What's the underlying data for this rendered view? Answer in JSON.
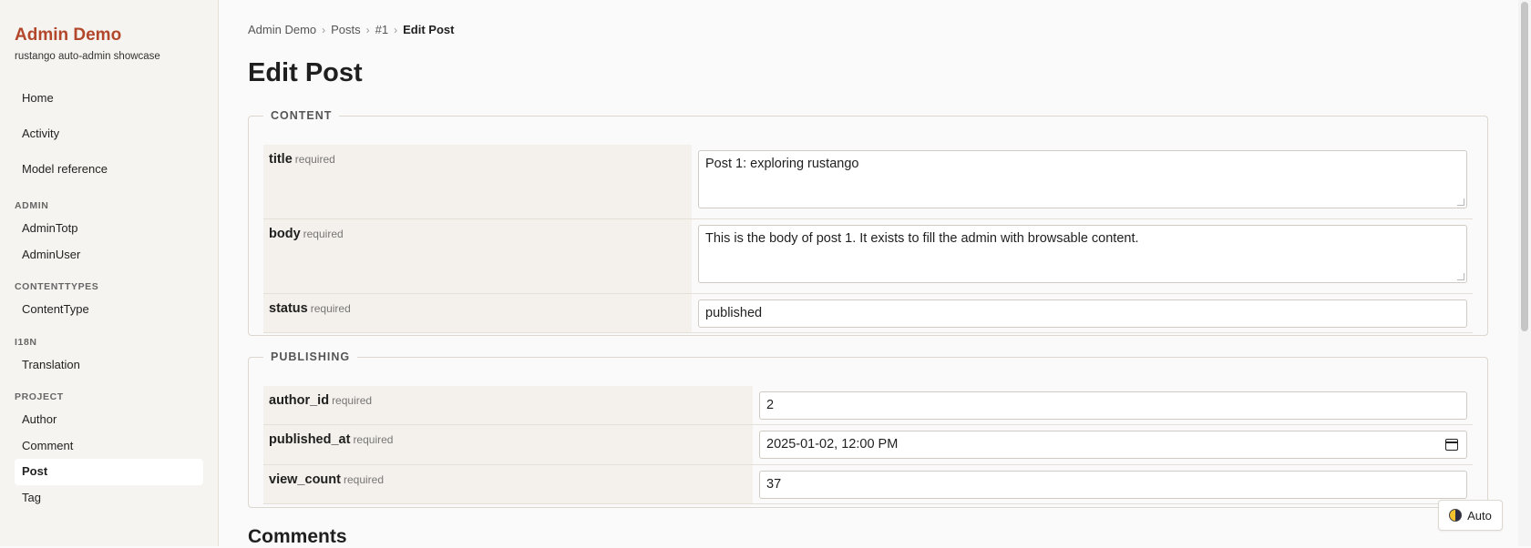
{
  "brand": {
    "title": "Admin Demo",
    "subtitle": "rustango auto-admin showcase"
  },
  "nav": {
    "top": [
      "Home",
      "Activity",
      "Model reference"
    ],
    "groups": [
      {
        "label": "ADMIN",
        "items": [
          "AdminTotp",
          "AdminUser"
        ]
      },
      {
        "label": "CONTENTTYPES",
        "items": [
          "ContentType"
        ]
      },
      {
        "label": "I18N",
        "items": [
          "Translation"
        ]
      },
      {
        "label": "PROJECT",
        "items": [
          "Author",
          "Comment",
          "Post",
          "Tag"
        ]
      }
    ],
    "active": "Post"
  },
  "breadcrumb": [
    "Admin Demo",
    "Posts",
    "#1",
    "Edit Post"
  ],
  "page_title": "Edit Post",
  "sections": [
    {
      "legend": "CONTENT",
      "fields": [
        {
          "name": "title",
          "hint": "required",
          "type": "textarea",
          "value": "Post 1: exploring rustango"
        },
        {
          "name": "body",
          "hint": "required",
          "type": "textarea",
          "value": "This is the body of post 1. It exists to fill the admin with browsable content."
        },
        {
          "name": "status",
          "hint": "required",
          "type": "text",
          "value": "published"
        }
      ]
    },
    {
      "legend": "PUBLISHING",
      "fields": [
        {
          "name": "author_id",
          "hint": "required",
          "type": "text",
          "value": "2"
        },
        {
          "name": "published_at",
          "hint": "required",
          "type": "datetime",
          "value": "2025-01-02, 12:00 PM"
        },
        {
          "name": "view_count",
          "hint": "required",
          "type": "text",
          "value": "37"
        }
      ]
    }
  ],
  "comments_heading": "Comments",
  "theme_toggle": {
    "label": "Auto",
    "icon": "half-moon-icon"
  },
  "colors": {
    "brand": "#b2472b",
    "label_bg": "#f4f0eb"
  }
}
